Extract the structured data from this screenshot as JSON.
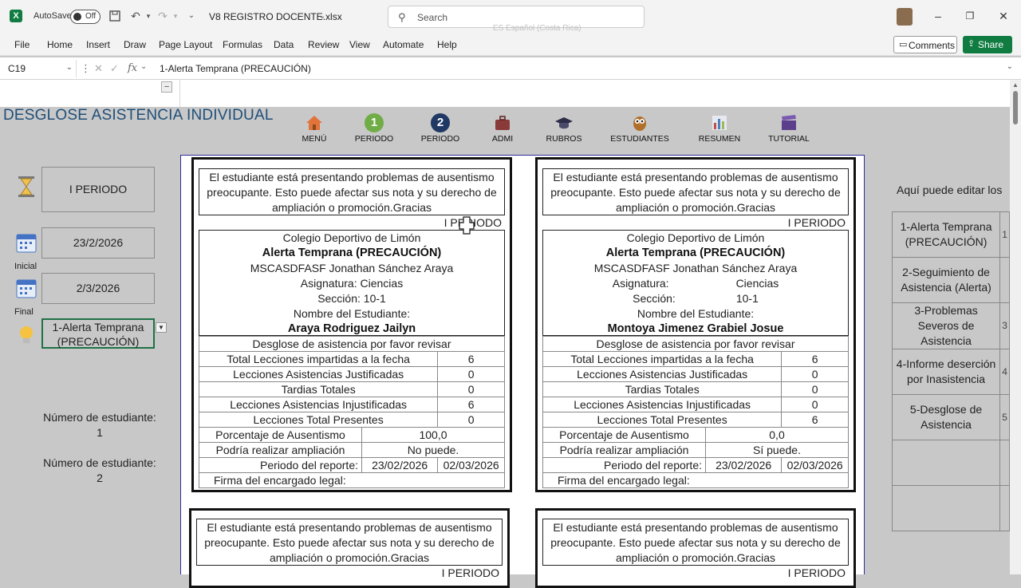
{
  "app": {
    "autosave_label": "AutoSave",
    "autosave_state": "Off",
    "document_name": "V8 REGISTRO DOCENTE.xlsx",
    "search_placeholder": "Search",
    "language_hint": "ES Español (Costa Rica)"
  },
  "menu": [
    "File",
    "Home",
    "Insert",
    "Draw",
    "Page Layout",
    "Formulas",
    "Data",
    "Review",
    "View",
    "Automate",
    "Help"
  ],
  "actions": {
    "comments": "Comments",
    "share": "Share"
  },
  "formula_bar": {
    "name_box": "C19",
    "value": "1-Alerta Temprana (PRECAUCIÓN)"
  },
  "sheet_title": "DESGLOSE ASISTENCIA INDIVIDUAL",
  "nav": [
    {
      "label": "MENÚ",
      "icon": "house-icon"
    },
    {
      "label": "PERIODO",
      "badge": "1",
      "color": "#70ad47",
      "icon": "period-1-icon"
    },
    {
      "label": "PERIODO",
      "badge": "2",
      "color": "#1f3864",
      "icon": "period-2-icon"
    },
    {
      "label": "ADMI",
      "icon": "briefcase-icon"
    },
    {
      "label": "RUBROS",
      "icon": "graduation-cap-icon"
    },
    {
      "label": "ESTUDIANTES",
      "icon": "owl-icon"
    },
    {
      "label": "RESUMEN",
      "icon": "bar-chart-icon"
    },
    {
      "label": "TUTORIAL",
      "icon": "clapperboard-icon"
    }
  ],
  "left_panel": {
    "period": "I PERIODO",
    "start_date": "23/2/2026",
    "start_label": "Inicial",
    "end_date": "2/3/2026",
    "end_label": "Final",
    "alert_selected": "1-Alerta Temprana (PRECAUCIÓN)",
    "student_num_label_1": "Número de estudiante:",
    "student_num_1": "1",
    "student_num_label_2": "Número de estudiante:",
    "student_num_2": "2"
  },
  "cards": [
    {
      "message": "El estudiante está presentando problemas de ausentismo preocupante. Esto puede afectar sus nota y su derecho de ampliación o promoción.Gracias",
      "period": "I PERIODO",
      "school": "Colegio Deportivo de Limón",
      "alert": "Alerta Temprana (PRECAUCIÓN)",
      "teacher": "MSCASDFASF Jonathan Sánchez Araya",
      "subject_label": "Asignatura:",
      "subject": "Ciencias",
      "section_label": "Sección:",
      "section": "10-1",
      "student_label": "Nombre del Estudiante:",
      "student": "Araya Rodriguez Jailyn",
      "breakdown_label": "Desglose de asistencia por favor revisar",
      "rows": [
        {
          "label": "Total Lecciones impartidas a la fecha",
          "value": "6"
        },
        {
          "label": "Lecciones Asistencias Justificadas",
          "value": "0"
        },
        {
          "label": "Tardias Totales",
          "value": "0"
        },
        {
          "label": "Lecciones Asistencias Injustificadas",
          "value": "6"
        },
        {
          "label": "Lecciones Total Presentes",
          "value": "0"
        }
      ],
      "absence_label": "Porcentaje de Ausentismo",
      "absence_value": "100,0",
      "ampliacion_label": "Podría realizar ampliación",
      "ampliacion_value": "No puede.",
      "report_period_label": "Periodo del reporte:",
      "report_from": "23/02/2026",
      "report_to": "02/03/2026",
      "signature_label": "Firma del encargado legal:"
    },
    {
      "message": "El estudiante está presentando problemas de ausentismo preocupante. Esto puede afectar sus nota y su derecho de ampliación o promoción.Gracias",
      "period": "I PERIODO",
      "school": "Colegio Deportivo de Limón",
      "alert": "Alerta Temprana (PRECAUCIÓN)",
      "teacher": "MSCASDFASF Jonathan Sánchez Araya",
      "subject_label": "Asignatura:",
      "subject": "Ciencias",
      "section_label": "Sección:",
      "section": "10-1",
      "student_label": "Nombre del Estudiante:",
      "student": "Montoya Jimenez Grabiel Josue",
      "breakdown_label": "Desglose de asistencia por favor revisar",
      "rows": [
        {
          "label": "Total Lecciones impartidas a la fecha",
          "value": "6"
        },
        {
          "label": "Lecciones Asistencias Justificadas",
          "value": "0"
        },
        {
          "label": "Tardias Totales",
          "value": "0"
        },
        {
          "label": "Lecciones Asistencias Injustificadas",
          "value": "0"
        },
        {
          "label": "Lecciones Total Presentes",
          "value": "6"
        }
      ],
      "absence_label": "Porcentaje de Ausentismo",
      "absence_value": "0,0",
      "ampliacion_label": "Podría realizar ampliación",
      "ampliacion_value": "Sí puede.",
      "report_period_label": "Periodo del reporte:",
      "report_from": "23/02/2026",
      "report_to": "02/03/2026",
      "signature_label": "Firma del encargado legal:"
    },
    {
      "message": "El estudiante está presentando problemas de ausentismo preocupante. Esto puede afectar sus nota y su derecho de ampliación o promoción.Gracias",
      "period": "I PERIODO"
    },
    {
      "message": "El estudiante está presentando problemas de ausentismo preocupante. Esto puede afectar sus nota y su derecho de ampliación o promoción.Gracias",
      "period": "I PERIODO"
    }
  ],
  "right_panel": {
    "title": "Aquí puede editar los",
    "options": [
      {
        "label": "1-Alerta Temprana (PRECAUCIÓN)",
        "side": "1"
      },
      {
        "label": "2-Seguimiento de Asistencia (Alerta)",
        "side": ""
      },
      {
        "label": "3-Problemas Severos de Asistencia",
        "side": "3"
      },
      {
        "label": "4-Informe deserción por Inasistencia",
        "side": "4"
      },
      {
        "label": "5-Desglose de Asistencia",
        "side": "5"
      },
      {
        "label": "",
        "side": ""
      },
      {
        "label": "",
        "side": ""
      }
    ]
  }
}
